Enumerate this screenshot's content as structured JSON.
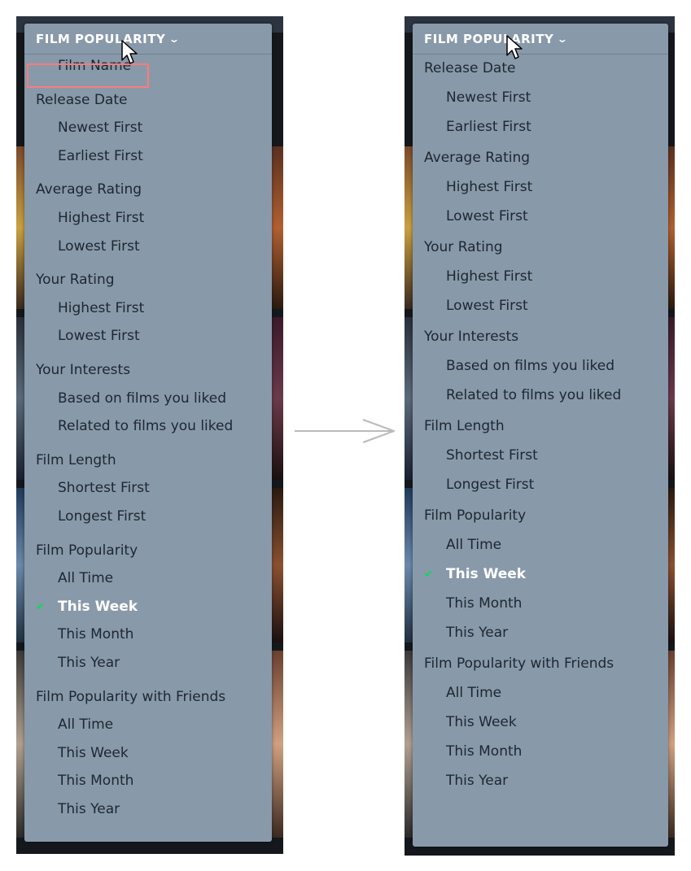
{
  "colors": {
    "menu_bg": "#8899aa",
    "item_text": "#1d2730",
    "selected_text": "#ffffff",
    "check": "#00e054",
    "highlight_box": "#ff7a7a"
  },
  "before": {
    "header": {
      "label": "FILM POPULARITY",
      "icon": "chevron-down-icon"
    },
    "items": [
      {
        "label": "Film Name",
        "type": "option",
        "highlighted": true
      },
      {
        "label": "Release Date",
        "type": "group"
      },
      {
        "label": "Newest First",
        "type": "option"
      },
      {
        "label": "Earliest First",
        "type": "option"
      },
      {
        "label": "Average Rating",
        "type": "group"
      },
      {
        "label": "Highest First",
        "type": "option"
      },
      {
        "label": "Lowest First",
        "type": "option"
      },
      {
        "label": "Your Rating",
        "type": "group"
      },
      {
        "label": "Highest First",
        "type": "option"
      },
      {
        "label": "Lowest First",
        "type": "option"
      },
      {
        "label": "Your Interests",
        "type": "group"
      },
      {
        "label": "Based on films you liked",
        "type": "option"
      },
      {
        "label": "Related to films you liked",
        "type": "option"
      },
      {
        "label": "Film Length",
        "type": "group"
      },
      {
        "label": "Shortest First",
        "type": "option"
      },
      {
        "label": "Longest First",
        "type": "option"
      },
      {
        "label": "Film Popularity",
        "type": "group"
      },
      {
        "label": "All Time",
        "type": "option"
      },
      {
        "label": "This Week",
        "type": "option",
        "selected": true
      },
      {
        "label": "This Month",
        "type": "option"
      },
      {
        "label": "This Year",
        "type": "option"
      },
      {
        "label": "Film Popularity with Friends",
        "type": "group"
      },
      {
        "label": "All Time",
        "type": "option"
      },
      {
        "label": "This Week",
        "type": "option"
      },
      {
        "label": "This Month",
        "type": "option"
      },
      {
        "label": "This Year",
        "type": "option"
      }
    ]
  },
  "after": {
    "header": {
      "label": "FILM POPULARITY",
      "icon": "chevron-down-icon"
    },
    "items": [
      {
        "label": "Release Date",
        "type": "group"
      },
      {
        "label": "Newest First",
        "type": "option"
      },
      {
        "label": "Earliest First",
        "type": "option"
      },
      {
        "label": "Average Rating",
        "type": "group"
      },
      {
        "label": "Highest First",
        "type": "option"
      },
      {
        "label": "Lowest First",
        "type": "option"
      },
      {
        "label": "Your Rating",
        "type": "group"
      },
      {
        "label": "Highest First",
        "type": "option"
      },
      {
        "label": "Lowest First",
        "type": "option"
      },
      {
        "label": "Your Interests",
        "type": "group"
      },
      {
        "label": "Based on films you liked",
        "type": "option"
      },
      {
        "label": "Related to films you liked",
        "type": "option"
      },
      {
        "label": "Film Length",
        "type": "group"
      },
      {
        "label": "Shortest First",
        "type": "option"
      },
      {
        "label": "Longest First",
        "type": "option"
      },
      {
        "label": "Film Popularity",
        "type": "group"
      },
      {
        "label": "All Time",
        "type": "option"
      },
      {
        "label": "This Week",
        "type": "option",
        "selected": true
      },
      {
        "label": "This Month",
        "type": "option"
      },
      {
        "label": "This Year",
        "type": "option"
      },
      {
        "label": "Film Popularity with Friends",
        "type": "group"
      },
      {
        "label": "All Time",
        "type": "option"
      },
      {
        "label": "This Week",
        "type": "option"
      },
      {
        "label": "This Month",
        "type": "option"
      },
      {
        "label": "This Year",
        "type": "option"
      }
    ]
  },
  "transition_icon": "right-arrow-icon"
}
